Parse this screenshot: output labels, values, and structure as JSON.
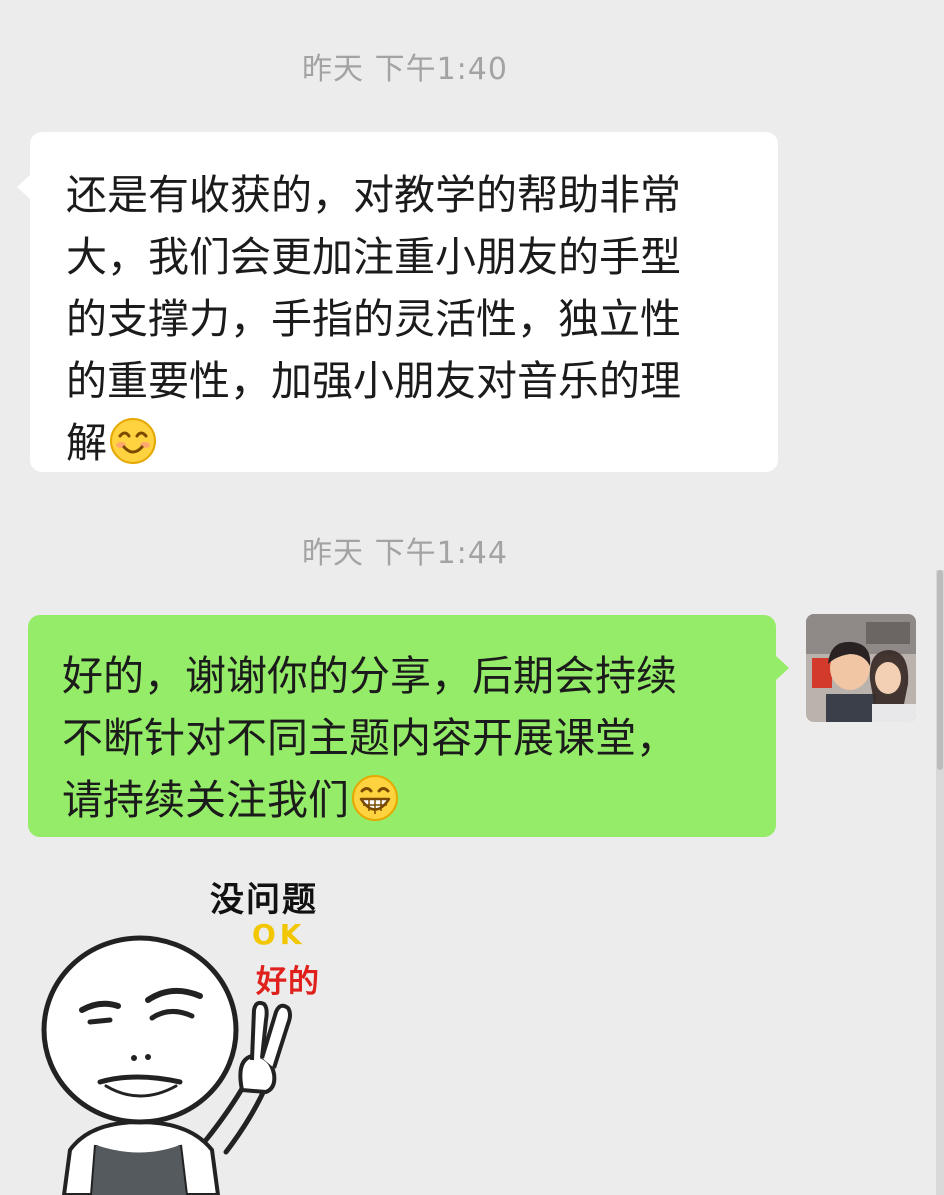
{
  "messages": [
    {
      "timestamp": "昨天 下午1:40",
      "direction": "incoming",
      "lines": [
        "还是有收获的，对教学的帮助非常",
        "大，我们会更加注重小朋友的手型",
        "的支撑力，手指的灵活性，独立性",
        "的重要性，加强小朋友对音乐的理",
        "解"
      ],
      "emoji": "smile-emoji"
    },
    {
      "timestamp": "昨天 下午1:44",
      "direction": "outgoing",
      "lines": [
        "好的，谢谢你的分享，后期会持续",
        "不断针对不同主题内容开展课堂，",
        "请持续关注我们"
      ],
      "emoji": "grin-emoji"
    }
  ],
  "sticker": {
    "line1": "没问题",
    "line2": "OK",
    "line3": "好的",
    "colors": {
      "line1": "#111111",
      "line2": "#f2c600",
      "line3": "#e0201c"
    }
  },
  "colors": {
    "background": "#ececec",
    "incoming_bubble": "#ffffff",
    "outgoing_bubble": "#95ec69",
    "timestamp_text": "#a3a3a3"
  }
}
